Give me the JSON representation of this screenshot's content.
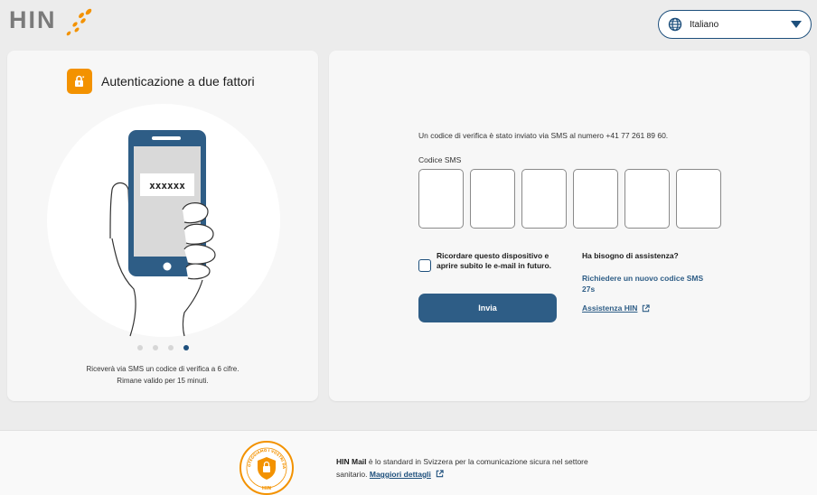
{
  "header": {
    "logo_text": "HIN",
    "language": {
      "selected": "Italiano",
      "icon": "globe-icon"
    }
  },
  "left_panel": {
    "title": "Autenticazione a due fattori",
    "phone_code": "xxxxxx",
    "carousel": {
      "total": 4,
      "active": 4
    },
    "caption_line1": "Riceverà via SMS un codice di verifica a 6 cifre.",
    "caption_line2": "Rimane valido per 15 minuti."
  },
  "form": {
    "info": "Un codice di verifica è stato inviato via SMS al numero +41 77 261 89 60.",
    "sms_label": "Codice SMS",
    "code_digits": [
      "",
      "",
      "",
      "",
      "",
      ""
    ],
    "remember_label": "Ricordare questo dispositivo e aprire subito le e-mail in futuro.",
    "remember_checked": false,
    "submit_label": "Invia"
  },
  "help": {
    "title": "Ha bisogno di assistenza?",
    "resend_label": "Richiedere un nuovo codice SMS",
    "resend_timer": "27s",
    "support_label": "Assistenza HIN"
  },
  "footer": {
    "brand": "HIN Mail",
    "text_part1": " è lo standard in Svizzera per la comunicazione sicura nel settore",
    "text_part2": "sanitario.",
    "more_label": "Maggiori dettagli",
    "seal_text": "PROTEGGIAMO I VOSTRI DATI",
    "seal_bottom": "HIN"
  },
  "colors": {
    "brand_orange": "#f39200",
    "primary_blue": "#2e5d86",
    "dark_blue": "#1d4f7c"
  }
}
